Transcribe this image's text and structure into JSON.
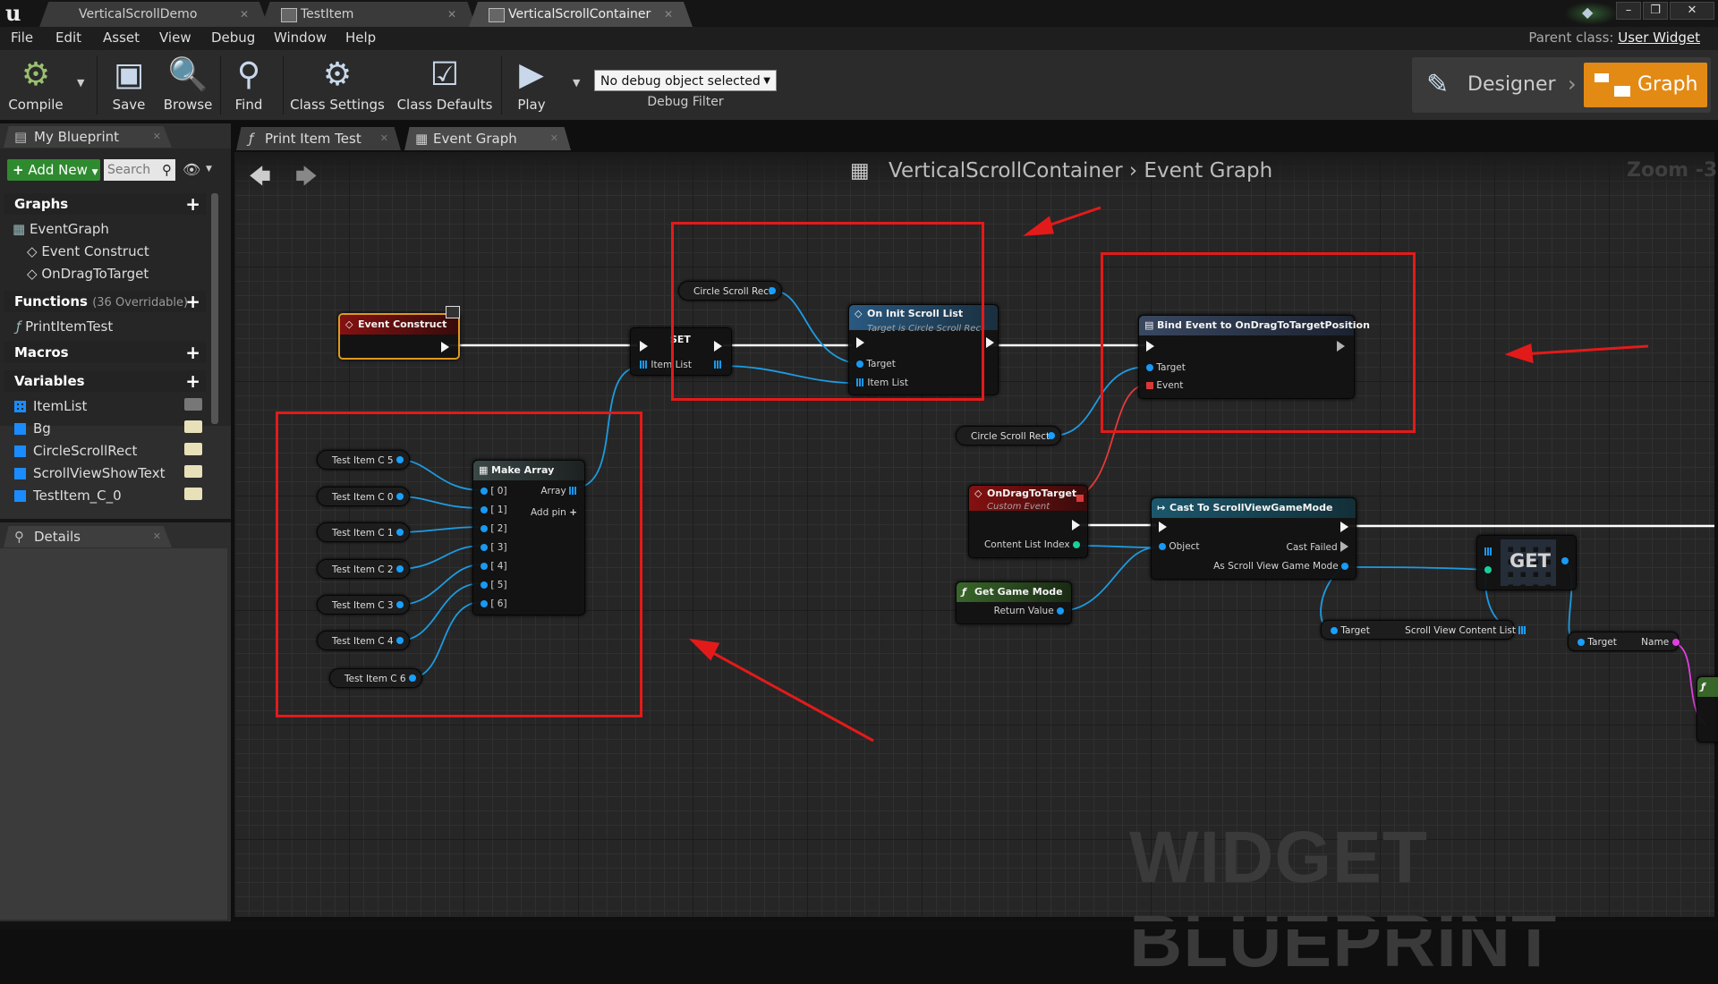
{
  "window": {
    "tabs": [
      {
        "label": "VerticalScrollDemo"
      },
      {
        "label": "TestItem"
      },
      {
        "label": "VerticalScrollContainer"
      }
    ]
  },
  "menu": [
    "File",
    "Edit",
    "Asset",
    "View",
    "Debug",
    "Window",
    "Help"
  ],
  "parent_class": {
    "label": "Parent class:",
    "value": "User Widget"
  },
  "toolbar": {
    "compile": "Compile",
    "save": "Save",
    "browse": "Browse",
    "find": "Find",
    "class_settings": "Class Settings",
    "class_defaults": "Class Defaults",
    "play": "Play",
    "debug_object": "No debug object selected",
    "debug_filter": "Debug Filter",
    "designer": "Designer",
    "graph": "Graph"
  },
  "my_blueprint": {
    "tab": "My Blueprint",
    "add_new": "Add New",
    "search_placeholder": "Search",
    "graphs_header": "Graphs",
    "graphs": [
      "EventGraph",
      "Event Construct",
      "OnDragToTarget"
    ],
    "functions_header": "Functions",
    "functions_sub": "(36 Overridable)",
    "functions": [
      "PrintItemTest"
    ],
    "macros_header": "Macros",
    "variables_header": "Variables",
    "variables": [
      {
        "name": "ItemList",
        "color": "#1a8cff"
      },
      {
        "name": "Bg",
        "color": "#1a8cff"
      },
      {
        "name": "CircleScrollRect",
        "color": "#1a8cff"
      },
      {
        "name": "ScrollViewShowText",
        "color": "#1a8cff"
      },
      {
        "name": "TestItem_C_0",
        "color": "#1a8cff"
      }
    ],
    "details_tab": "Details"
  },
  "graph_tabs": [
    "Print Item Test",
    "Event Graph"
  ],
  "breadcrumb": {
    "blueprint": "VerticalScrollContainer",
    "graph": "Event Graph"
  },
  "zoom": "Zoom -3",
  "watermark": "WIDGET BLUEPRINT",
  "nodes": {
    "event_construct": "Event Construct",
    "set": "SET",
    "set_item_list": "Item List",
    "circle_scroll_rect": "Circle Scroll Rect",
    "on_init": {
      "title": "On Init Scroll List",
      "subtitle": "Target is Circle Scroll Rect",
      "target": "Target",
      "item_list": "Item List"
    },
    "bind_event": {
      "title": "Bind Event to OnDragToTargetPosition",
      "target": "Target",
      "event": "Event"
    },
    "circle_scroll_rect_2": "Circle Scroll Rect",
    "make_array": {
      "title": "Make Array",
      "array": "Array",
      "add_pin": "Add pin",
      "indices": [
        "[ 0]",
        "[ 1]",
        "[ 2]",
        "[ 3]",
        "[ 4]",
        "[ 5]",
        "[ 6]"
      ]
    },
    "test_items": [
      "Test Item C 5",
      "Test Item C 0",
      "Test Item C 1",
      "Test Item C 2",
      "Test Item C 3",
      "Test Item C 4",
      "Test Item C 6"
    ],
    "on_drag": {
      "title": "OnDragToTarget",
      "subtitle": "Custom Event",
      "content_list_index": "Content List Index"
    },
    "cast": {
      "title": "Cast To ScrollViewGameMode",
      "object": "Object",
      "cast_failed": "Cast Failed",
      "as_mode": "As Scroll View Game Mode"
    },
    "get_game_mode": {
      "title": "Get Game Mode",
      "return_value": "Return Value"
    },
    "get": "GET",
    "content_list": {
      "target": "Target",
      "value": "Scroll View Content List"
    },
    "name_getter": {
      "target": "Target",
      "name": "Name"
    }
  },
  "colors": {
    "accent": "#e38a14",
    "annotation": "#e31a1a",
    "pin_blue": "#18a0ff"
  }
}
